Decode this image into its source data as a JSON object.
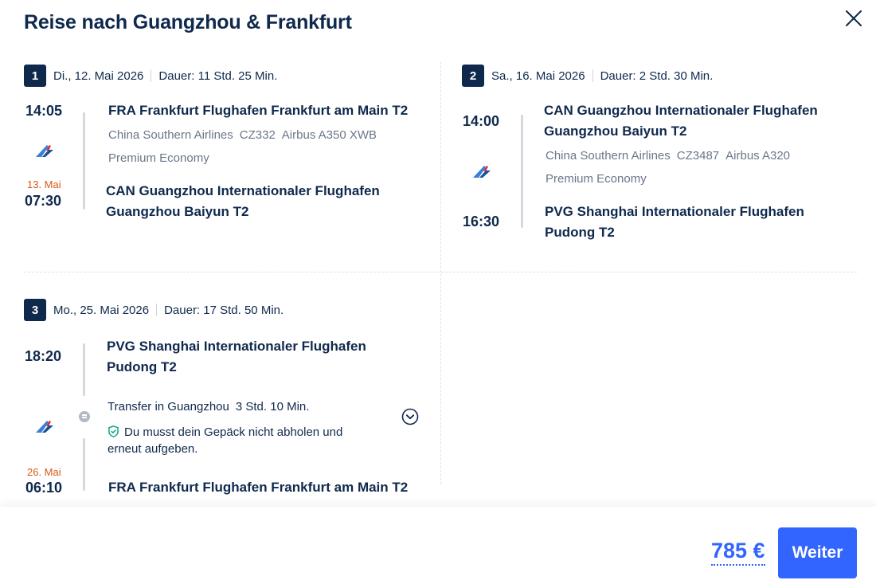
{
  "dialog": {
    "title": "Reise nach Guangzhou & Frankfurt"
  },
  "segments": [
    {
      "number": "1",
      "date": "Di., 12. Mai 2026",
      "duration": "Dauer: 11 Std. 25 Min.",
      "departure": {
        "time": "14:05",
        "airport": "FRA Frankfurt Flughafen Frankfurt am Main T2"
      },
      "airline": "China Southern Airlines",
      "flight_number": "CZ332",
      "aircraft": "Airbus A350 XWB",
      "cabin": "Premium Economy",
      "arrival": {
        "date_note": "13. Mai",
        "time": "07:30",
        "airport": "CAN Guangzhou Internationaler Flughafen Guangzhou Baiyun T2"
      }
    },
    {
      "number": "2",
      "date": "Sa., 16. Mai 2026",
      "duration": "Dauer: 2 Std. 30 Min.",
      "departure": {
        "time": "14:00",
        "airport": "CAN Guangzhou Internationaler Flughafen Guangzhou Baiyun T2"
      },
      "airline": "China Southern Airlines",
      "flight_number": "CZ3487",
      "aircraft": "Airbus A320",
      "cabin": "Premium Economy",
      "arrival": {
        "time": "16:30",
        "airport": "PVG Shanghai Internationaler Flughafen Pudong T2"
      }
    },
    {
      "number": "3",
      "date": "Mo., 25. Mai 2026",
      "duration": "Dauer: 17 Std. 50 Min.",
      "departure": {
        "time": "18:20",
        "airport": "PVG Shanghai Internationaler Flughafen Pudong T2"
      },
      "transfer": {
        "label": "Transfer in Guangzhou",
        "duration": "3 Std. 10 Min.",
        "baggage_note": "Du musst dein Gepäck nicht abholen und erneut aufgeben."
      },
      "arrival": {
        "date_note": "26. Mai",
        "time": "06:10",
        "airport": "FRA Frankfurt Flughafen Frankfurt am Main T2"
      }
    }
  ],
  "footer": {
    "price": "785 €",
    "continue_label": "Weiter"
  },
  "icons": {
    "close": "close-icon",
    "airline_logo": "china-southern-airlines-logo-icon",
    "transfer": "transfer-icon",
    "shield": "shield-check-icon",
    "expand": "chevron-down-circle-icon"
  },
  "colors": {
    "text": "#0f294d",
    "muted": "#6b7689",
    "accent": "#3264ff",
    "next_day": "#d65a12"
  }
}
